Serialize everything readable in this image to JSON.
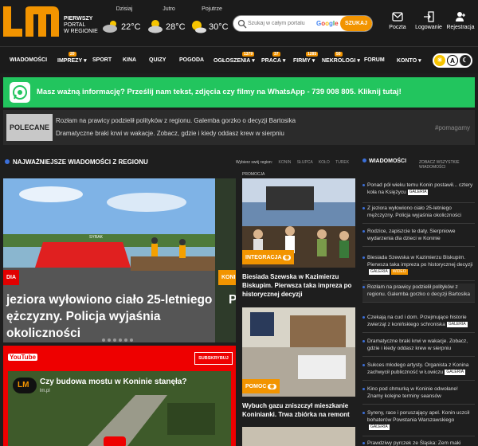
{
  "header": {
    "logo": "LM",
    "portal_line1": "PIERWSZY",
    "portal_line2": "PORTAL",
    "portal_line3": "W REGIONIE",
    "weather": [
      {
        "day": "Dzisiaj",
        "temp": "22°C",
        "icon": "cloud-sun-icon"
      },
      {
        "day": "Jutro",
        "temp": "28°C",
        "icon": "cloud-sun-icon"
      },
      {
        "day": "Pojutrze",
        "temp": "30°C",
        "icon": "sun-cloud-icon"
      }
    ],
    "search_placeholder": "Szukaj w całym portalu",
    "search_provider": "Google",
    "search_button": "SZUKAJ",
    "links": {
      "mail": "Poczta",
      "login": "Logowanie",
      "register": "Rejestracja"
    }
  },
  "nav": {
    "items": [
      {
        "label": "WIADOMOŚCI",
        "badge": ""
      },
      {
        "label": "IMPREZY",
        "badge": "20"
      },
      {
        "label": "SPORT",
        "badge": ""
      },
      {
        "label": "KINA",
        "badge": ""
      },
      {
        "label": "QUIZY",
        "badge": ""
      },
      {
        "label": "POGODA",
        "badge": ""
      },
      {
        "label": "OGŁOSZENIA",
        "badge": "1379"
      },
      {
        "label": "PRACA",
        "badge": "37"
      },
      {
        "label": "FIRMY",
        "badge": "1285"
      },
      {
        "label": "NEKROLOGI",
        "badge": "50"
      },
      {
        "label": "FORUM",
        "badge": ""
      },
      {
        "label": "KONTO",
        "badge": ""
      }
    ],
    "theme_label": "A"
  },
  "whatsapp_banner": "Masz ważną informację? Prześlij nam tekst, zdjęcia czy filmy na WhatsApp - 739 008 805. Kliknij tutaj!",
  "recommended": {
    "label": "POLECANE",
    "items": [
      "Rozłam na prawicy podzielił polityków z regionu. Galemba gorzko o decyzji Bartosika",
      "Dramatyczne braki krwi w wakacje. Zobacz, gdzie i kiedy oddasz krew w sierpniu"
    ],
    "hashtag": "#pomagamy"
  },
  "main": {
    "section_title": "NAJWAŻNIEJSZE WIADOMOŚCI Z REGIONU",
    "region_label": "Wybierz swój region:",
    "regions": [
      "KONIN",
      "SŁUPCA",
      "KOŁO",
      "TUREK"
    ],
    "hero": {
      "category": "DIA",
      "title": "jeziora wyłowiono ciało 25-letniego ężczyzny. Policja wyjaśnia okoliczności",
      "category2": "KONI",
      "title2": "P",
      "boat_label": "SYRAK"
    },
    "youtube": {
      "logo": "YouTube",
      "subscribe": "SUBSKRYBUJ",
      "video_title": "Czy budowa mostu w Koninie stanęła?",
      "channel": "lm.pl"
    }
  },
  "promo": {
    "label": "PROMOCJA",
    "cards": [
      {
        "category": "INTEGRACJA",
        "text": "Biesiada Szewska w Kazimierzu Biskupim. Pierwsza taka impreza po historycznej decyzji"
      },
      {
        "category": "POMOC",
        "text": "Wybuch gazu zniszczył mieszkanie Koninianki. Trwa zbiórka na remont"
      }
    ]
  },
  "sidebar": {
    "title": "WIADOMOŚCI",
    "link": "ZOBACZ WSZYSTKIE WIADOMOŚCI",
    "items": [
      {
        "text": "Ponad pół wieku temu Konin postawił... cztery koła na Księżycu",
        "badge": "GALERIA",
        "badge2": ""
      },
      {
        "text": "Z jeziora wyłowiono ciało 25-letniego mężczyzny. Policja wyjaśnia okoliczności",
        "badge": "",
        "badge2": ""
      },
      {
        "text": "Rodzice, zapiszcie te daty. Sierpniowe wydarzenia dla dzieci w Koninie",
        "badge": "",
        "badge2": ""
      },
      {
        "text": "Biesiada Szewska w Kazimierzu Biskupim. Pierwsza taka impreza po historycznej decyzji",
        "badge": "GALERIA",
        "badge2": "WIDEO"
      },
      {
        "text": "Rozłam na prawicy podzielił polityków z regionu. Galemba gorzko o decyzji Bartosika",
        "badge": "",
        "badge2": ""
      },
      {
        "text": "Czekają na cud i dom. Przejmujące historie zwierząt z konińskiego schroniska",
        "badge": "GALERIA",
        "badge2": ""
      },
      {
        "text": "Dramatyczne braki krwi w wakacje. Zobacz, gdzie i kiedy oddasz krew w sierpniu",
        "badge": "",
        "badge2": ""
      },
      {
        "text": "Sukces młodego artysty. Organista z Konina zachwycił publiczność w Łowiczu",
        "badge": "GALERIA",
        "badge2": ""
      },
      {
        "text": "Kino pod chmurką w Koninie odwołane! Znamy kolejne terminy seansów",
        "badge": "",
        "badge2": ""
      },
      {
        "text": "Syreny, race i poruszający apel. Konin uczcił bohaterów Powstania Warszawskiego",
        "badge": "GALERIA",
        "badge2": ""
      },
      {
        "text": "Prawdziwy pyrczek ze Śląska: Zem maki",
        "badge": "",
        "badge2": ""
      }
    ]
  },
  "colors": {
    "accent": "#f29400",
    "whatsapp": "#22c55e",
    "youtube": "#e00000",
    "link": "#3b6fd9"
  }
}
